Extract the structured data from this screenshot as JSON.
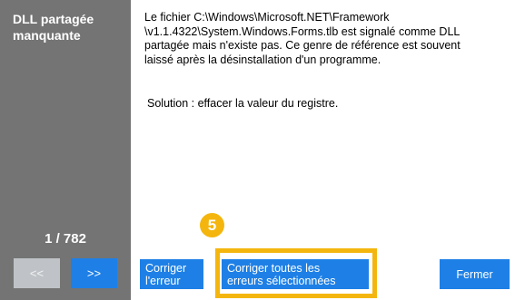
{
  "sidebar": {
    "title": "DLL partagée manquante",
    "counter": "1 / 782",
    "prev_label": "<<",
    "next_label": ">>"
  },
  "message": {
    "lines": [
      "Le fichier C:\\Windows\\Microsoft.NET\\Framework",
      "\\v1.1.4322\\System.Windows.Forms.tlb est signalé comme DLL",
      "partagée mais n'existe pas. Ce genre de référence est souvent",
      "laissé après la désinstallation d'un programme."
    ],
    "solution": "Solution : effacer la valeur du registre."
  },
  "actions": {
    "fix_label_line1": "Corriger",
    "fix_label_line2": "l'erreur",
    "fix_all_label_line1": "Corriger toutes les",
    "fix_all_label_line2": "erreurs sélectionnées",
    "close_label": "Fermer"
  },
  "annotation": {
    "step_number": "5",
    "highlight_color": "#f4b60e"
  },
  "colors": {
    "sidebar_bg": "#747474",
    "button_blue": "#1e80e6",
    "button_disabled": "#bfc3c7"
  }
}
